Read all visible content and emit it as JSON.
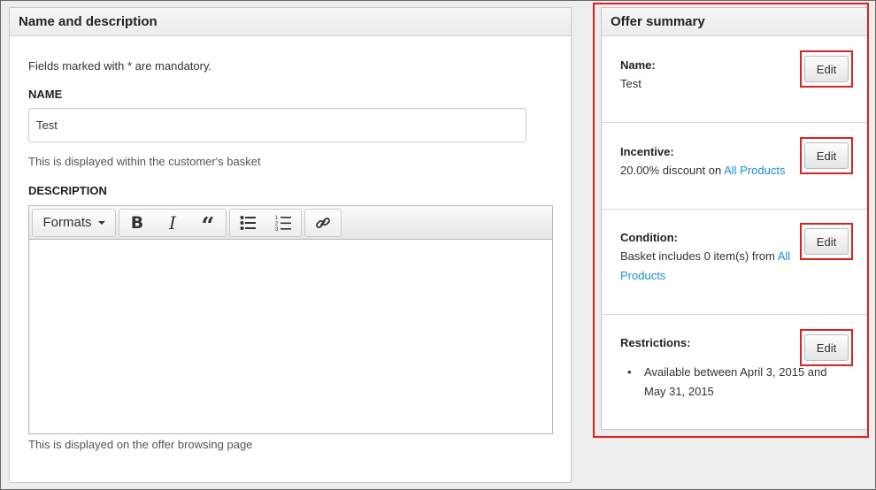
{
  "name_panel": {
    "heading": "Name and description",
    "mandatory_note": "Fields marked with * are mandatory.",
    "name_label": "NAME",
    "name_value": "Test",
    "name_help": "This is displayed within the customer's basket",
    "description_label": "DESCRIPTION",
    "description_help": "This is displayed on the offer browsing page",
    "toolbar": {
      "formats_label": "Formats",
      "buttons": [
        "bold-icon",
        "italic-icon",
        "blockquote-icon",
        "bullet-list-icon",
        "numbered-list-icon",
        "link-icon"
      ]
    }
  },
  "summary_panel": {
    "heading": "Offer summary",
    "edit_label": "Edit",
    "name": {
      "title": "Name:",
      "value": "Test"
    },
    "incentive": {
      "title": "Incentive:",
      "text": "20.00% discount on ",
      "link": "All Products"
    },
    "condition": {
      "title": "Condition:",
      "text": "Basket includes 0 item(s) from ",
      "link": "All Products"
    },
    "restrictions": {
      "title": "Restrictions:",
      "items": [
        "Available between April 3, 2015 and May 31, 2015"
      ]
    }
  },
  "colors": {
    "highlight": "#e02020",
    "link": "#1a8ed6"
  }
}
